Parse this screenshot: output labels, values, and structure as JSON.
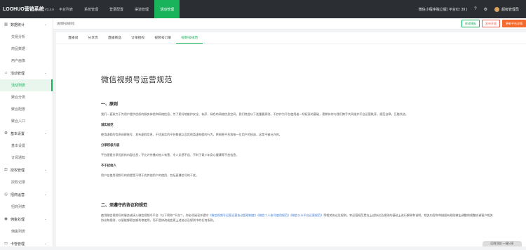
{
  "brand": {
    "name": "LOOHUO营销系统",
    "version": "V3.4.0"
  },
  "topnav": [
    {
      "label": "平台列表",
      "active": false
    },
    {
      "label": "系统管理",
      "active": false
    },
    {
      "label": "登录配置",
      "active": false
    },
    {
      "label": "渠道管理",
      "active": false
    },
    {
      "label": "活动管理",
      "active": true
    }
  ],
  "topright": {
    "account": "微信小程序独立版( 平台ID: 39 )",
    "help_icon": "question-circle-icon",
    "settings_icon": "gear-icon",
    "user": "超级管理员"
  },
  "sidebar": {
    "groups": [
      {
        "label": "数据统计",
        "icon": "bar-chart-icon",
        "items": [
          "交易分析",
          "商品数据",
          "用户画像"
        ]
      },
      {
        "label": "活动管理",
        "icon": "tag-icon",
        "items": [
          "活动列表",
          "聚合分类",
          "聚合配置",
          "聚合入口"
        ],
        "active_item": "活动列表"
      },
      {
        "label": "基本设置",
        "icon": "gear-icon",
        "items": [
          "基本设置",
          "订阅通知"
        ]
      },
      {
        "label": "授权管理",
        "icon": "key-icon",
        "items": [
          "授权记录"
        ]
      },
      {
        "label": "招商运营",
        "icon": "store-icon",
        "items": [
          "招商列表"
        ]
      },
      {
        "label": "佣金处理",
        "icon": "wallet-icon",
        "items": [
          "佣金列表"
        ]
      },
      {
        "label": "卡管管理",
        "icon": "card-icon",
        "items": []
      }
    ]
  },
  "breadcrumb": "[视频号规则]",
  "crumb_buttons": {
    "preview": "修改模板",
    "publish": "发布开放",
    "action": "更新平台详情"
  },
  "tabs": [
    {
      "label": "直播间",
      "active": false
    },
    {
      "label": "分享页",
      "active": false
    },
    {
      "label": "直播商品",
      "active": false
    },
    {
      "label": "订单授权",
      "active": false
    },
    {
      "label": "视频号订单",
      "active": false
    },
    {
      "label": "视频号规范",
      "active": true
    }
  ],
  "document": {
    "title": "微信视频号运营规范",
    "section1": {
      "heading": "一、原则",
      "intro": "我们一直致力于为用户提供优质的服务体验和网络信息，为了更好地维护安全、有序、绿色的网络信息空间，我们特此以下述重要原则，不仅作为平台使用者一切权责的基础，更期待你与我们携手共同维护平台运营秩序，规范自律，互融共进。",
      "sub1_title": "诚实规范",
      "sub1_text": "使用虚假的信息创建账号、发布虚假信息、干扰真实的平台数据以及其他类虚构假的行为，将损害平台和每一位用户的权益，这是不被允许的。",
      "sub2_title": "分享积极内容",
      "sub2_text": "平台提倡分享优质的内容信息，不允许传播对他人有害、令人反感不适、不利于青少年身心健康等不良信息。",
      "sub3_title": "不干扰他人",
      "sub3_text": "用户在使用视频号的前提是不得干扰其他用户的使用，包括直播信号的干扰。"
    },
    "section2": {
      "heading": "二、须遵守的协议和规范",
      "text_a": "使用微信视频号的服务或接入微信视频号平台（以下简称 \"平台\"），你必须阅读并遵守",
      "link1": "《微信视频号运营运营协议管理制度》",
      "link2": "《微信个人账号使用规范》",
      "link3": "《微信公众平台运营规范》",
      "text_b": "等相关协议及规则。本运营规范是在上述协议及规则的基础上进行解释和说明，相关内容和举措固有规则做出调整和规整协调客户相关协议和规则，以便能够更加顺利地使用，而不是修改或变更上述协议及规则中的任何条款。"
    }
  },
  "float_button": "回到顶部   一键分享"
}
